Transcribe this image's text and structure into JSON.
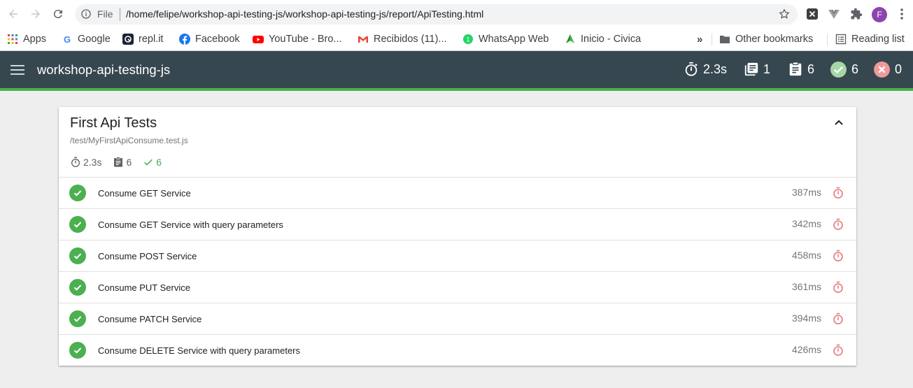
{
  "browser": {
    "scheme": "File",
    "url": "/home/felipe/workshop-api-testing-js/workshop-api-testing-js/report/ApiTesting.html",
    "profile_initial": "F",
    "bookmarks": [
      {
        "label": "Apps",
        "icon": "apps-grid-icon"
      },
      {
        "label": "Google",
        "icon": "google-icon"
      },
      {
        "label": "repl.it",
        "icon": "replit-icon"
      },
      {
        "label": "Facebook",
        "icon": "facebook-icon"
      },
      {
        "label": "YouTube - Bro...",
        "icon": "youtube-icon"
      },
      {
        "label": "Recibidos (11)...",
        "icon": "gmail-icon"
      },
      {
        "label": "WhatsApp Web",
        "icon": "whatsapp-icon"
      },
      {
        "label": "Inicio - Civica",
        "icon": "civica-icon"
      }
    ],
    "overflow_label": "»",
    "other_bookmarks": "Other bookmarks",
    "reading_list": "Reading list"
  },
  "report": {
    "title": "workshop-api-testing-js",
    "stats": {
      "duration": "2.3s",
      "suites": "1",
      "tests": "6",
      "passes": "6",
      "failures": "0"
    },
    "suite": {
      "title": "First Api Tests",
      "file": "/test/MyFirstApiConsume.test.js",
      "duration": "2.3s",
      "tests": "6",
      "passes": "6",
      "tests_list": [
        {
          "title": "Consume GET Service",
          "duration": "387ms"
        },
        {
          "title": "Consume GET Service with query parameters",
          "duration": "342ms"
        },
        {
          "title": "Consume POST Service",
          "duration": "458ms"
        },
        {
          "title": "Consume PUT Service",
          "duration": "361ms"
        },
        {
          "title": "Consume PATCH Service",
          "duration": "394ms"
        },
        {
          "title": "Consume DELETE Service with query parameters",
          "duration": "426ms"
        }
      ]
    }
  },
  "colors": {
    "appbar": "#36474f",
    "accent_green": "#4caf50",
    "fail_red": "#f44336",
    "timer_red": "#e57373"
  }
}
